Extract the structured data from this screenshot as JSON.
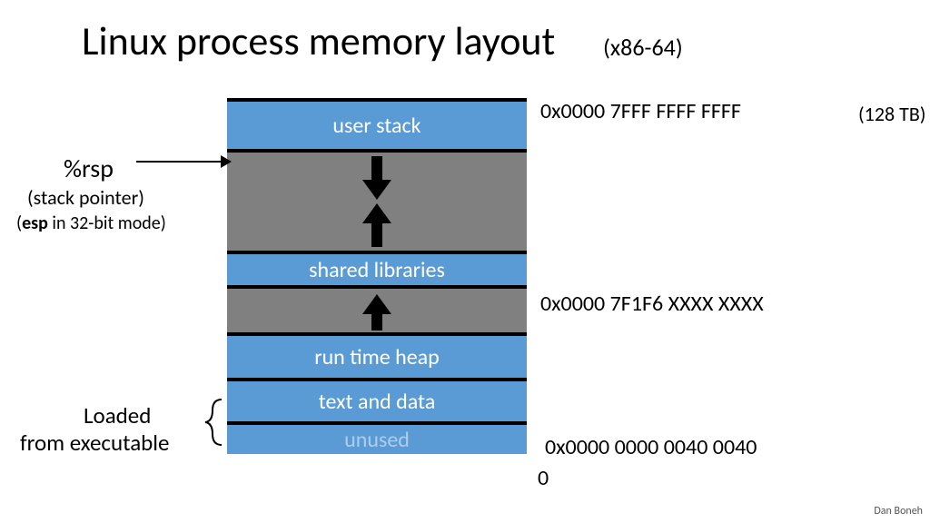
{
  "title": "Linux process memory layout",
  "subtitle": "(x86-64)",
  "segments": {
    "user_stack": "user stack",
    "shared_libs": "shared libraries",
    "heap": "run time heap",
    "text_data": "text and data",
    "unused": "unused"
  },
  "addresses": {
    "top": "0x0000 7FFF FFFF FFFF",
    "top_size": "(128 TB)",
    "mid": "0x0000 7F1F6 XXXX XXXX",
    "low": "0x0000 0000 0040 0040",
    "zero": "0"
  },
  "rsp": {
    "label": "%rsp",
    "sub1": "(stack pointer)",
    "sub2_prefix": "(",
    "sub2_bold": "esp",
    "sub2_suffix": " in 32-bit mode)"
  },
  "loaded": {
    "line1": "Loaded",
    "line2": "from executable"
  },
  "attribution": "Dan Boneh"
}
